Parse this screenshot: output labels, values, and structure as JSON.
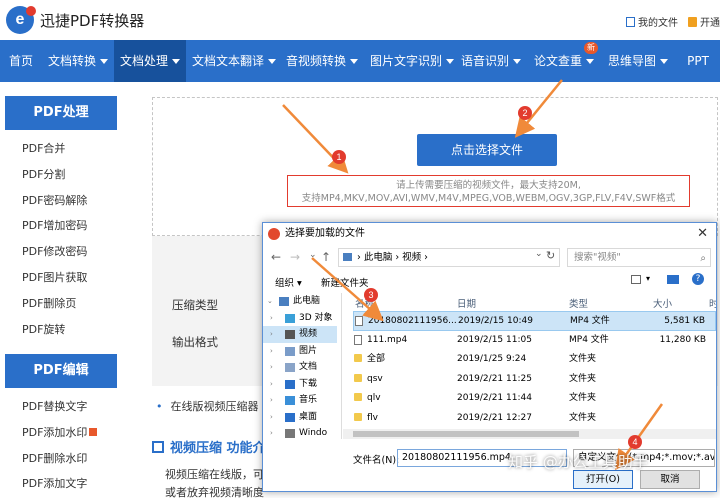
{
  "app": {
    "logo_letter": "e",
    "title": "迅捷PDF转换器",
    "my_files": "我的文件",
    "open_vip": "开通"
  },
  "nav": {
    "items": [
      {
        "label": "首页",
        "caret": false
      },
      {
        "label": "文档转换",
        "caret": true
      },
      {
        "label": "文档处理",
        "caret": true,
        "active": true
      },
      {
        "label": "文档文本翻译",
        "caret": true
      },
      {
        "label": "音视频转换",
        "caret": true
      },
      {
        "label": "图片文字识别",
        "caret": true
      },
      {
        "label": "语音识别",
        "caret": true
      },
      {
        "label": "论文查重",
        "caret": true,
        "badge": "新"
      },
      {
        "label": "思维导图",
        "caret": true
      },
      {
        "label": "PPT",
        "caret": false
      }
    ]
  },
  "sidebar": {
    "group1_title": "PDF处理",
    "group1_items": [
      "PDF合并",
      "PDF分割",
      "PDF密码解除",
      "PDF增加密码",
      "PDF修改密码",
      "PDF图片获取",
      "PDF删除页",
      "PDF旋转"
    ],
    "group2_title": "PDF编辑",
    "group2_items": [
      "PDF替换文字",
      "PDF添加水印",
      "PDF删除水印",
      "PDF添加文字"
    ]
  },
  "upload": {
    "button_label": "点击选择文件",
    "hint_line1": "请上传需要压缩的视频文件，最大支持20M,",
    "hint_line2": "支持MP4,MKV,MOV,AVI,WMV,M4V,MPEG,VOB,WEBM,OGV,3GP,FLV,F4V,SWF格式"
  },
  "form": {
    "compress_type_label": "压缩类型",
    "output_format_label": "输出格式"
  },
  "content": {
    "bullet_text": "在线版视频压缩器",
    "section_title": "视频压缩 功能介",
    "desc_line1": "视频压缩在线版，可",
    "desc_line2": "或者放弃视频清晰度"
  },
  "steps": [
    "1",
    "2",
    "3",
    "4"
  ],
  "dialog": {
    "title": "选择要加载的文件",
    "close": "✕",
    "nav_back": "←",
    "nav_forward": "→",
    "nav_recent": "⌄",
    "nav_up": "↑",
    "path": "› 此电脑 › 视频 ›",
    "search_placeholder": "搜索\"视频\"",
    "organize": "组织 ▾",
    "new_folder": "新建文件夹",
    "tree": [
      {
        "label": "此电脑",
        "root": true,
        "color": "#4a7fc0"
      },
      {
        "label": "3D 对象",
        "color": "#3aa0d8"
      },
      {
        "label": "视频",
        "sel": true,
        "color": "#555"
      },
      {
        "label": "图片",
        "color": "#7a9cc9"
      },
      {
        "label": "文档",
        "color": "#8aa4c8"
      },
      {
        "label": "下载",
        "color": "#2a6fc9"
      },
      {
        "label": "音乐",
        "color": "#3a8fd8"
      },
      {
        "label": "桌面",
        "color": "#2a6fc9"
      },
      {
        "label": "Windo",
        "color": "#777"
      }
    ],
    "columns": {
      "name": "名称",
      "date": "日期",
      "type": "类型",
      "size": "大小",
      "extra": "时"
    },
    "files": [
      {
        "name": "20180802111956...",
        "date": "2019/2/15 10:49",
        "type": "MP4 文件",
        "size": "5,581 KB",
        "kind": "file",
        "sel": true
      },
      {
        "name": "111.mp4",
        "date": "2019/2/15 11:05",
        "type": "MP4 文件",
        "size": "11,280 KB",
        "kind": "file"
      },
      {
        "name": "全部",
        "date": "2019/1/25 9:24",
        "type": "文件夹",
        "size": "",
        "kind": "folder"
      },
      {
        "name": "qsv",
        "date": "2019/2/21 11:25",
        "type": "文件夹",
        "size": "",
        "kind": "folder"
      },
      {
        "name": "qlv",
        "date": "2019/2/21 11:44",
        "type": "文件夹",
        "size": "",
        "kind": "folder"
      },
      {
        "name": "flv",
        "date": "2019/2/21 12:27",
        "type": "文件夹",
        "size": "",
        "kind": "folder"
      }
    ],
    "filename_label": "文件名(N):",
    "filename_value": "20180802111956.mp4",
    "filetype_value": "自定义文件 (*.mp4;*.mov;*.avi",
    "open_label": "打开(O)",
    "cancel_label": "取消"
  },
  "watermark": "知乎 @办公工具助手"
}
